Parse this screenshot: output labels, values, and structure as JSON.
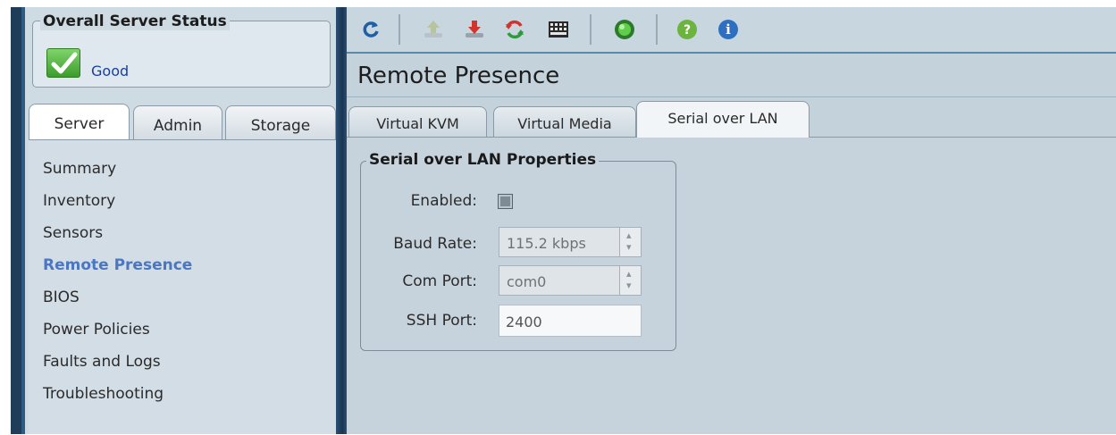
{
  "server_status": {
    "legend": "Overall Server Status",
    "value": "Good",
    "icon": "check-icon"
  },
  "left_tabs": [
    {
      "label": "Server",
      "active": true
    },
    {
      "label": "Admin",
      "active": false
    },
    {
      "label": "Storage",
      "active": false
    }
  ],
  "nav": {
    "items": [
      {
        "label": "Summary"
      },
      {
        "label": "Inventory"
      },
      {
        "label": "Sensors"
      },
      {
        "label": "Remote Presence",
        "active": true
      },
      {
        "label": "BIOS"
      },
      {
        "label": "Power Policies"
      },
      {
        "label": "Faults and Logs"
      },
      {
        "label": "Troubleshooting"
      }
    ]
  },
  "toolbar": {
    "icons": [
      "refresh-icon",
      "upload-icon",
      "download-icon",
      "sync-icon",
      "keyboard-icon",
      "power-indicator-icon",
      "help-icon",
      "info-icon"
    ]
  },
  "page": {
    "title": "Remote Presence"
  },
  "content_tabs": [
    {
      "label": "Virtual KVM",
      "active": false
    },
    {
      "label": "Virtual Media",
      "active": false
    },
    {
      "label": "Serial over LAN",
      "active": true
    }
  ],
  "sol_properties": {
    "legend": "Serial over LAN Properties",
    "enabled_label": "Enabled:",
    "enabled": false,
    "baud_label": "Baud Rate:",
    "baud_value": "115.2 kbps",
    "com_label": "Com Port:",
    "com_value": "com0",
    "ssh_label": "SSH Port:",
    "ssh_value": "2400"
  },
  "colors": {
    "accent_dark": "#1f3c59",
    "active_nav": "#4a76c2",
    "status_good": "#1a3da6"
  }
}
